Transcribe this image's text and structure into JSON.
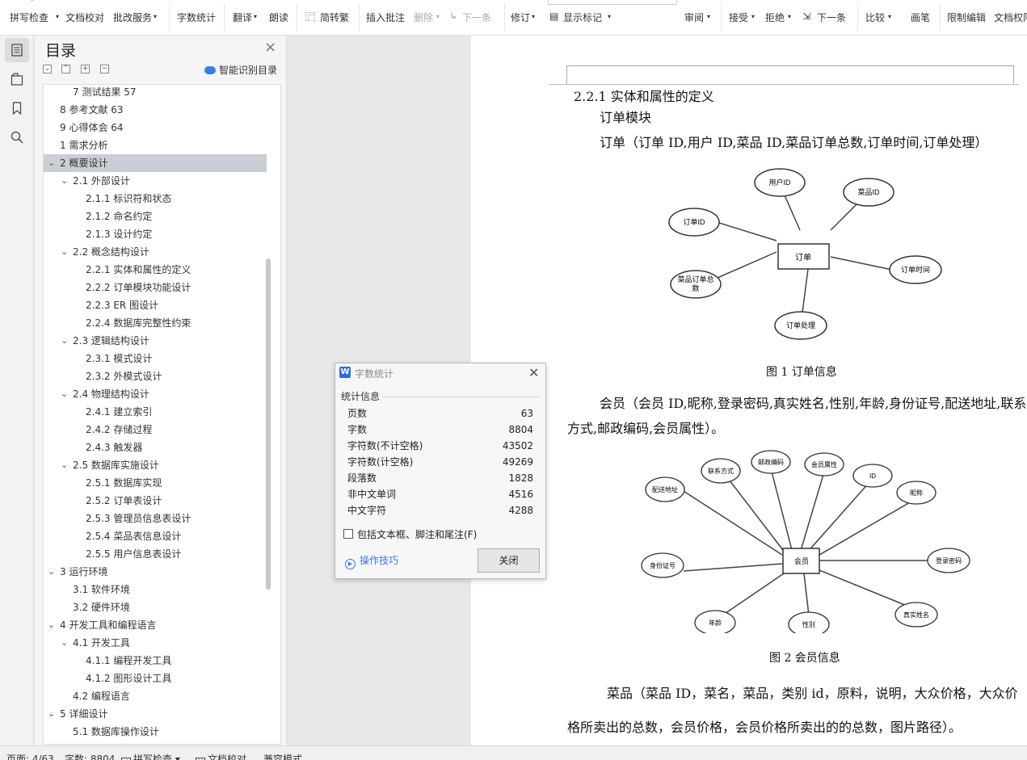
{
  "ribbon": {
    "spell_check": "拼写检查",
    "doc_proof": "文档校对",
    "review_service": "批改服务",
    "word_count": "字数统计",
    "translate": "翻译",
    "read_aloud": "朗读",
    "trad_simp": "简转繁",
    "insert_comment": "插入批注",
    "delete": "删除",
    "next_comment": "下一条",
    "track_changes": "修订",
    "show_markup": "显示标记",
    "review": "审阅",
    "accept": "接受",
    "reject": "拒绝",
    "next_change": "下一条",
    "compare": "比较",
    "ink": "画笔",
    "restrict_edit": "限制编辑",
    "doc_rights": "文档权限"
  },
  "toc": {
    "title": "目录",
    "smart_label": "智能识别目录",
    "items": [
      {
        "label": "7  测试结果  57"
      },
      {
        "label": "8  参考文献  63"
      },
      {
        "label": "9  心得体会  64"
      },
      {
        "label": "1  需求分析"
      },
      {
        "label": "2  概要设计"
      },
      {
        "label": "2.1  外部设计"
      },
      {
        "label": "2.1.1  标识符和状态"
      },
      {
        "label": "2.1.2  命名约定"
      },
      {
        "label": "2.1.3  设计约定"
      },
      {
        "label": "2.2  概念结构设计"
      },
      {
        "label": "2.2.1  实体和属性的定义"
      },
      {
        "label": "2.2.2  订单模块功能设计"
      },
      {
        "label": "2.2.3    ER 图设计"
      },
      {
        "label": "2.2.4  数据库完整性约束"
      },
      {
        "label": "2.3  逻辑结构设计"
      },
      {
        "label": "2.3.1 模式设计"
      },
      {
        "label": "2.3.2  外模式设计"
      },
      {
        "label": "2.4  物理结构设计"
      },
      {
        "label": "2.4.1  建立索引"
      },
      {
        "label": "2.4.2  存储过程"
      },
      {
        "label": "2.4.3  触发器"
      },
      {
        "label": "2.5  数据库实施设计"
      },
      {
        "label": "2.5.1  数据库实现"
      },
      {
        "label": "2.5.2  订单表设计"
      },
      {
        "label": "2.5.3  管理员信息表设计"
      },
      {
        "label": "2.5.4  菜品表信息设计"
      },
      {
        "label": "2.5.5  用户信息表设计"
      },
      {
        "label": "3  运行环境"
      },
      {
        "label": "3.1    软件环境"
      },
      {
        "label": "3.2 硬件环境"
      },
      {
        "label": "4  开发工具和编程语言"
      },
      {
        "label": "4.1 开发工具"
      },
      {
        "label": "4.1.1 编程开发工具"
      },
      {
        "label": "4.1.2 图形设计工具"
      },
      {
        "label": "4.2 编程语言"
      },
      {
        "label": "5  详细设计"
      },
      {
        "label": "5.1  数据库操作设计"
      }
    ]
  },
  "document": {
    "heading": "2.2.1  实体和属性的定义",
    "module": "订单模块",
    "order_def": "订单（订单 ID,用户 ID,菜品 ID,菜品订单总数,订单时间,订单处理）",
    "fig1": {
      "center": "订单",
      "attrs": [
        "用户ID",
        "菜品ID",
        "订单ID",
        "订单时间",
        "菜品订单总",
        "数",
        "订单处理"
      ],
      "caption": "图 1   订单信息"
    },
    "member_def_1": "会员（会员 ID,昵称,登录密码,真实姓名,性别,年龄,身份证号,配送地址,联系",
    "member_def_2": "方式,邮政编码,会员属性）。",
    "fig2": {
      "center": "会员",
      "attrs": [
        "配送地址",
        "联系方式",
        "邮政编码",
        "会员属性",
        "ID",
        "昵称",
        "身份证号",
        "登录密码",
        "年龄",
        "性别",
        "真实姓名"
      ],
      "caption": "图 2  会员信息"
    },
    "dish_def_1": "菜品（菜品 ID，菜名，菜品，类别 id，原料，说明，大众价格，大众价",
    "dish_def_2": "格所卖出的总数，会员价格，会员价格所卖出的的总数，图片路径）。"
  },
  "word_count_dialog": {
    "title": "字数统计",
    "section": "统计信息",
    "rows": [
      {
        "label": "页数",
        "value": "63"
      },
      {
        "label": "字数",
        "value": "8804"
      },
      {
        "label": "字符数(不计空格)",
        "value": "43502"
      },
      {
        "label": "字符数(计空格)",
        "value": "49269"
      },
      {
        "label": "段落数",
        "value": "1828"
      },
      {
        "label": "非中文单词",
        "value": "4516"
      },
      {
        "label": "中文字符",
        "value": "4288"
      }
    ],
    "checkbox_label": "包括文本框、脚注和尾注(F)",
    "tips": "操作技巧",
    "close": "关闭"
  },
  "status": {
    "page": "页面: 4/63",
    "words": "字数: 8804",
    "spell": "拼写检查",
    "proof": "文档校对",
    "compat": "兼容模式"
  },
  "colors": {
    "accent": "#3b78d8",
    "toc_selected": "#c9ced6"
  }
}
